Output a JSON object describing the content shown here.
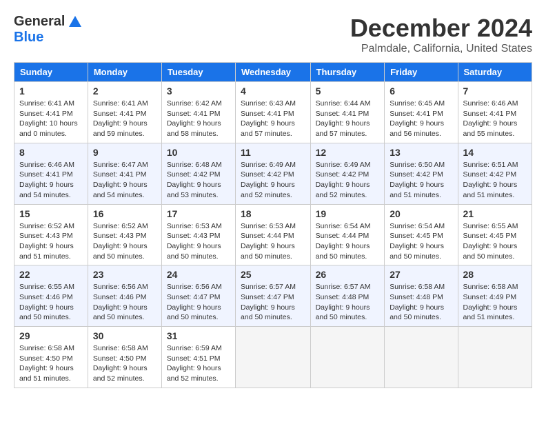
{
  "logo": {
    "general": "General",
    "blue": "Blue"
  },
  "title": "December 2024",
  "location": "Palmdale, California, United States",
  "days_of_week": [
    "Sunday",
    "Monday",
    "Tuesday",
    "Wednesday",
    "Thursday",
    "Friday",
    "Saturday"
  ],
  "weeks": [
    [
      {
        "day": "1",
        "sunrise": "Sunrise: 6:41 AM",
        "sunset": "Sunset: 4:41 PM",
        "daylight": "Daylight: 10 hours and 0 minutes."
      },
      {
        "day": "2",
        "sunrise": "Sunrise: 6:41 AM",
        "sunset": "Sunset: 4:41 PM",
        "daylight": "Daylight: 9 hours and 59 minutes."
      },
      {
        "day": "3",
        "sunrise": "Sunrise: 6:42 AM",
        "sunset": "Sunset: 4:41 PM",
        "daylight": "Daylight: 9 hours and 58 minutes."
      },
      {
        "day": "4",
        "sunrise": "Sunrise: 6:43 AM",
        "sunset": "Sunset: 4:41 PM",
        "daylight": "Daylight: 9 hours and 57 minutes."
      },
      {
        "day": "5",
        "sunrise": "Sunrise: 6:44 AM",
        "sunset": "Sunset: 4:41 PM",
        "daylight": "Daylight: 9 hours and 57 minutes."
      },
      {
        "day": "6",
        "sunrise": "Sunrise: 6:45 AM",
        "sunset": "Sunset: 4:41 PM",
        "daylight": "Daylight: 9 hours and 56 minutes."
      },
      {
        "day": "7",
        "sunrise": "Sunrise: 6:46 AM",
        "sunset": "Sunset: 4:41 PM",
        "daylight": "Daylight: 9 hours and 55 minutes."
      }
    ],
    [
      {
        "day": "8",
        "sunrise": "Sunrise: 6:46 AM",
        "sunset": "Sunset: 4:41 PM",
        "daylight": "Daylight: 9 hours and 54 minutes."
      },
      {
        "day": "9",
        "sunrise": "Sunrise: 6:47 AM",
        "sunset": "Sunset: 4:41 PM",
        "daylight": "Daylight: 9 hours and 54 minutes."
      },
      {
        "day": "10",
        "sunrise": "Sunrise: 6:48 AM",
        "sunset": "Sunset: 4:42 PM",
        "daylight": "Daylight: 9 hours and 53 minutes."
      },
      {
        "day": "11",
        "sunrise": "Sunrise: 6:49 AM",
        "sunset": "Sunset: 4:42 PM",
        "daylight": "Daylight: 9 hours and 52 minutes."
      },
      {
        "day": "12",
        "sunrise": "Sunrise: 6:49 AM",
        "sunset": "Sunset: 4:42 PM",
        "daylight": "Daylight: 9 hours and 52 minutes."
      },
      {
        "day": "13",
        "sunrise": "Sunrise: 6:50 AM",
        "sunset": "Sunset: 4:42 PM",
        "daylight": "Daylight: 9 hours and 51 minutes."
      },
      {
        "day": "14",
        "sunrise": "Sunrise: 6:51 AM",
        "sunset": "Sunset: 4:42 PM",
        "daylight": "Daylight: 9 hours and 51 minutes."
      }
    ],
    [
      {
        "day": "15",
        "sunrise": "Sunrise: 6:52 AM",
        "sunset": "Sunset: 4:43 PM",
        "daylight": "Daylight: 9 hours and 51 minutes."
      },
      {
        "day": "16",
        "sunrise": "Sunrise: 6:52 AM",
        "sunset": "Sunset: 4:43 PM",
        "daylight": "Daylight: 9 hours and 50 minutes."
      },
      {
        "day": "17",
        "sunrise": "Sunrise: 6:53 AM",
        "sunset": "Sunset: 4:43 PM",
        "daylight": "Daylight: 9 hours and 50 minutes."
      },
      {
        "day": "18",
        "sunrise": "Sunrise: 6:53 AM",
        "sunset": "Sunset: 4:44 PM",
        "daylight": "Daylight: 9 hours and 50 minutes."
      },
      {
        "day": "19",
        "sunrise": "Sunrise: 6:54 AM",
        "sunset": "Sunset: 4:44 PM",
        "daylight": "Daylight: 9 hours and 50 minutes."
      },
      {
        "day": "20",
        "sunrise": "Sunrise: 6:54 AM",
        "sunset": "Sunset: 4:45 PM",
        "daylight": "Daylight: 9 hours and 50 minutes."
      },
      {
        "day": "21",
        "sunrise": "Sunrise: 6:55 AM",
        "sunset": "Sunset: 4:45 PM",
        "daylight": "Daylight: 9 hours and 50 minutes."
      }
    ],
    [
      {
        "day": "22",
        "sunrise": "Sunrise: 6:55 AM",
        "sunset": "Sunset: 4:46 PM",
        "daylight": "Daylight: 9 hours and 50 minutes."
      },
      {
        "day": "23",
        "sunrise": "Sunrise: 6:56 AM",
        "sunset": "Sunset: 4:46 PM",
        "daylight": "Daylight: 9 hours and 50 minutes."
      },
      {
        "day": "24",
        "sunrise": "Sunrise: 6:56 AM",
        "sunset": "Sunset: 4:47 PM",
        "daylight": "Daylight: 9 hours and 50 minutes."
      },
      {
        "day": "25",
        "sunrise": "Sunrise: 6:57 AM",
        "sunset": "Sunset: 4:47 PM",
        "daylight": "Daylight: 9 hours and 50 minutes."
      },
      {
        "day": "26",
        "sunrise": "Sunrise: 6:57 AM",
        "sunset": "Sunset: 4:48 PM",
        "daylight": "Daylight: 9 hours and 50 minutes."
      },
      {
        "day": "27",
        "sunrise": "Sunrise: 6:58 AM",
        "sunset": "Sunset: 4:48 PM",
        "daylight": "Daylight: 9 hours and 50 minutes."
      },
      {
        "day": "28",
        "sunrise": "Sunrise: 6:58 AM",
        "sunset": "Sunset: 4:49 PM",
        "daylight": "Daylight: 9 hours and 51 minutes."
      }
    ],
    [
      {
        "day": "29",
        "sunrise": "Sunrise: 6:58 AM",
        "sunset": "Sunset: 4:50 PM",
        "daylight": "Daylight: 9 hours and 51 minutes."
      },
      {
        "day": "30",
        "sunrise": "Sunrise: 6:58 AM",
        "sunset": "Sunset: 4:50 PM",
        "daylight": "Daylight: 9 hours and 52 minutes."
      },
      {
        "day": "31",
        "sunrise": "Sunrise: 6:59 AM",
        "sunset": "Sunset: 4:51 PM",
        "daylight": "Daylight: 9 hours and 52 minutes."
      },
      null,
      null,
      null,
      null
    ]
  ]
}
